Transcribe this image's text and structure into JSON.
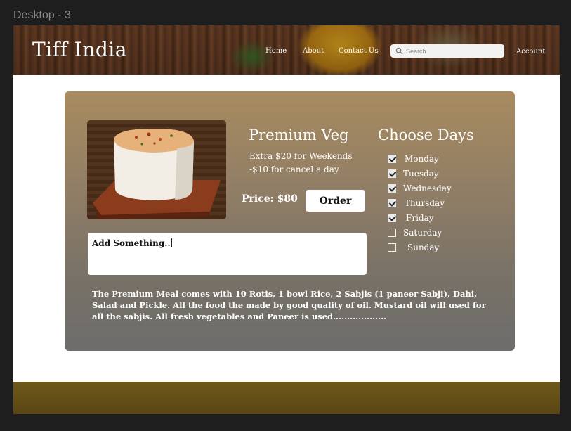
{
  "frame": {
    "label": "Desktop - 3"
  },
  "header": {
    "logo": "Tiff India",
    "nav": [
      "Home",
      "About",
      "Contact Us"
    ],
    "search_placeholder": "Search",
    "account": "Account"
  },
  "product": {
    "title": "Premium Veg",
    "notes": [
      "Extra $20 for Weekends",
      "-$10 for cancel a day"
    ],
    "price_label": "Price: $80",
    "order_label": "Order",
    "input_value": "Add Something..",
    "description": "The Premium Meal comes with 10 Rotis, 1 bowl Rice, 2 Sabjis (1 paneer Sabji), Dahi, Salad and Pickle. All the food the made by good quality of oil. Mustard oil will used for all the sabjis. All fresh vegetables and Paneer is used..................."
  },
  "days": {
    "title": "Choose Days",
    "items": [
      {
        "label": "Monday",
        "checked": true
      },
      {
        "label": "Tuesday",
        "checked": true
      },
      {
        "label": "Wednesday",
        "checked": true
      },
      {
        "label": "Thursday",
        "checked": true
      },
      {
        "label": "Friday",
        "checked": true
      },
      {
        "label": "Saturday",
        "checked": false
      },
      {
        "label": "Sunday",
        "checked": false
      }
    ]
  },
  "colors": {
    "card_top": "#a88b5f",
    "card_bottom": "#6e6d6c",
    "footer": "#6e5819"
  },
  "icons": {
    "search": "search-icon"
  }
}
